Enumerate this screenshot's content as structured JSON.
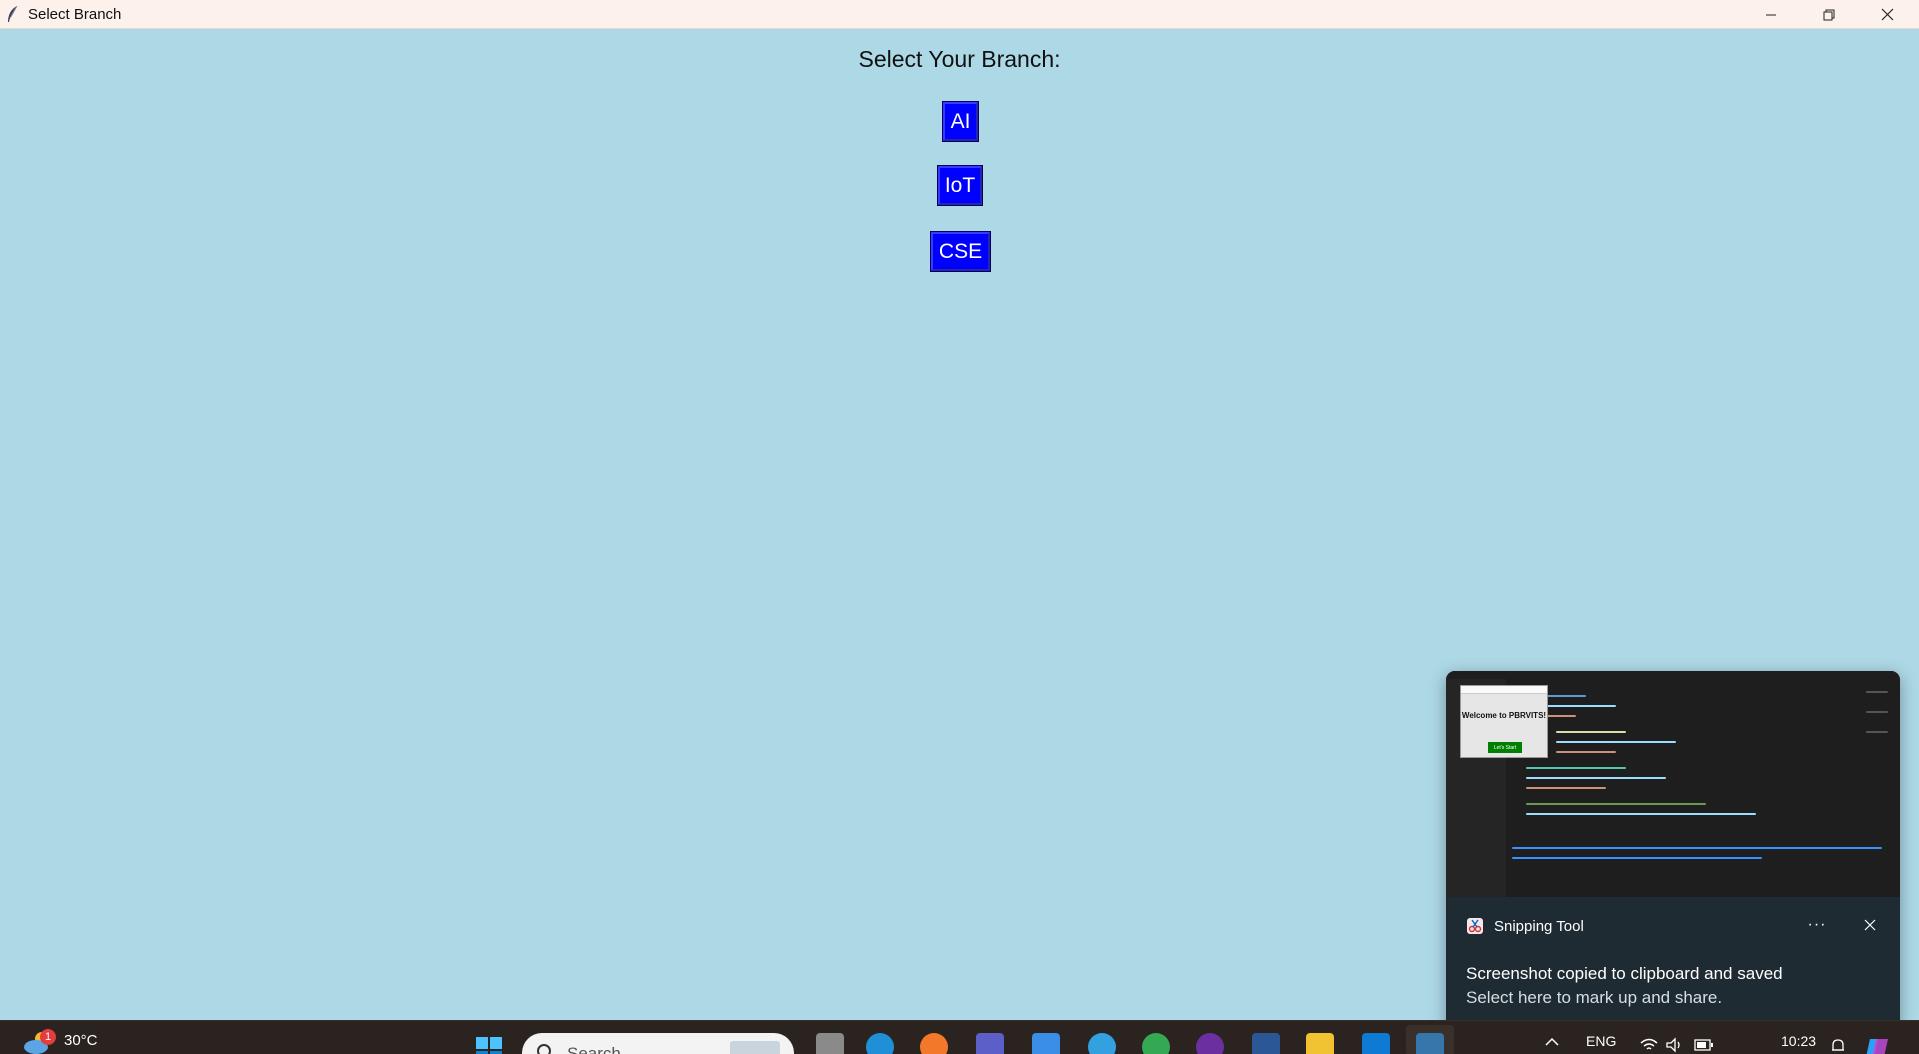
{
  "window": {
    "title": "Select Branch",
    "title_bar_bg": "#fdf1ec",
    "content_bg": "#add8e6"
  },
  "content": {
    "heading": "Select Your Branch:",
    "buttons": [
      {
        "label": "AI",
        "bg": "#0000ff"
      },
      {
        "label": "IoT",
        "bg": "#0000ff"
      },
      {
        "label": "CSE",
        "bg": "#0000ff"
      }
    ]
  },
  "notification": {
    "app_name": "Snipping Tool",
    "title": "Screenshot copied to clipboard and saved",
    "body": "Select here to mark up and share.",
    "more_label": "···",
    "thumbnail": {
      "dialog_text": "Welcome to PBRVITS!",
      "dialog_button": "Let's Start"
    }
  },
  "taskbar": {
    "weather": {
      "temperature": "30°C",
      "badge": "1"
    },
    "search_placeholder": "Search",
    "tray": {
      "language": "ENG",
      "time": "10:23"
    },
    "pinned_icons": [
      "task-view-icon",
      "edge-icon",
      "firefox-icon",
      "teams-icon",
      "store-icon",
      "paint-icon",
      "chrome-icon",
      "obs-icon",
      "word-icon",
      "file-explorer-icon",
      "vscode-icon",
      "python-icon"
    ]
  }
}
